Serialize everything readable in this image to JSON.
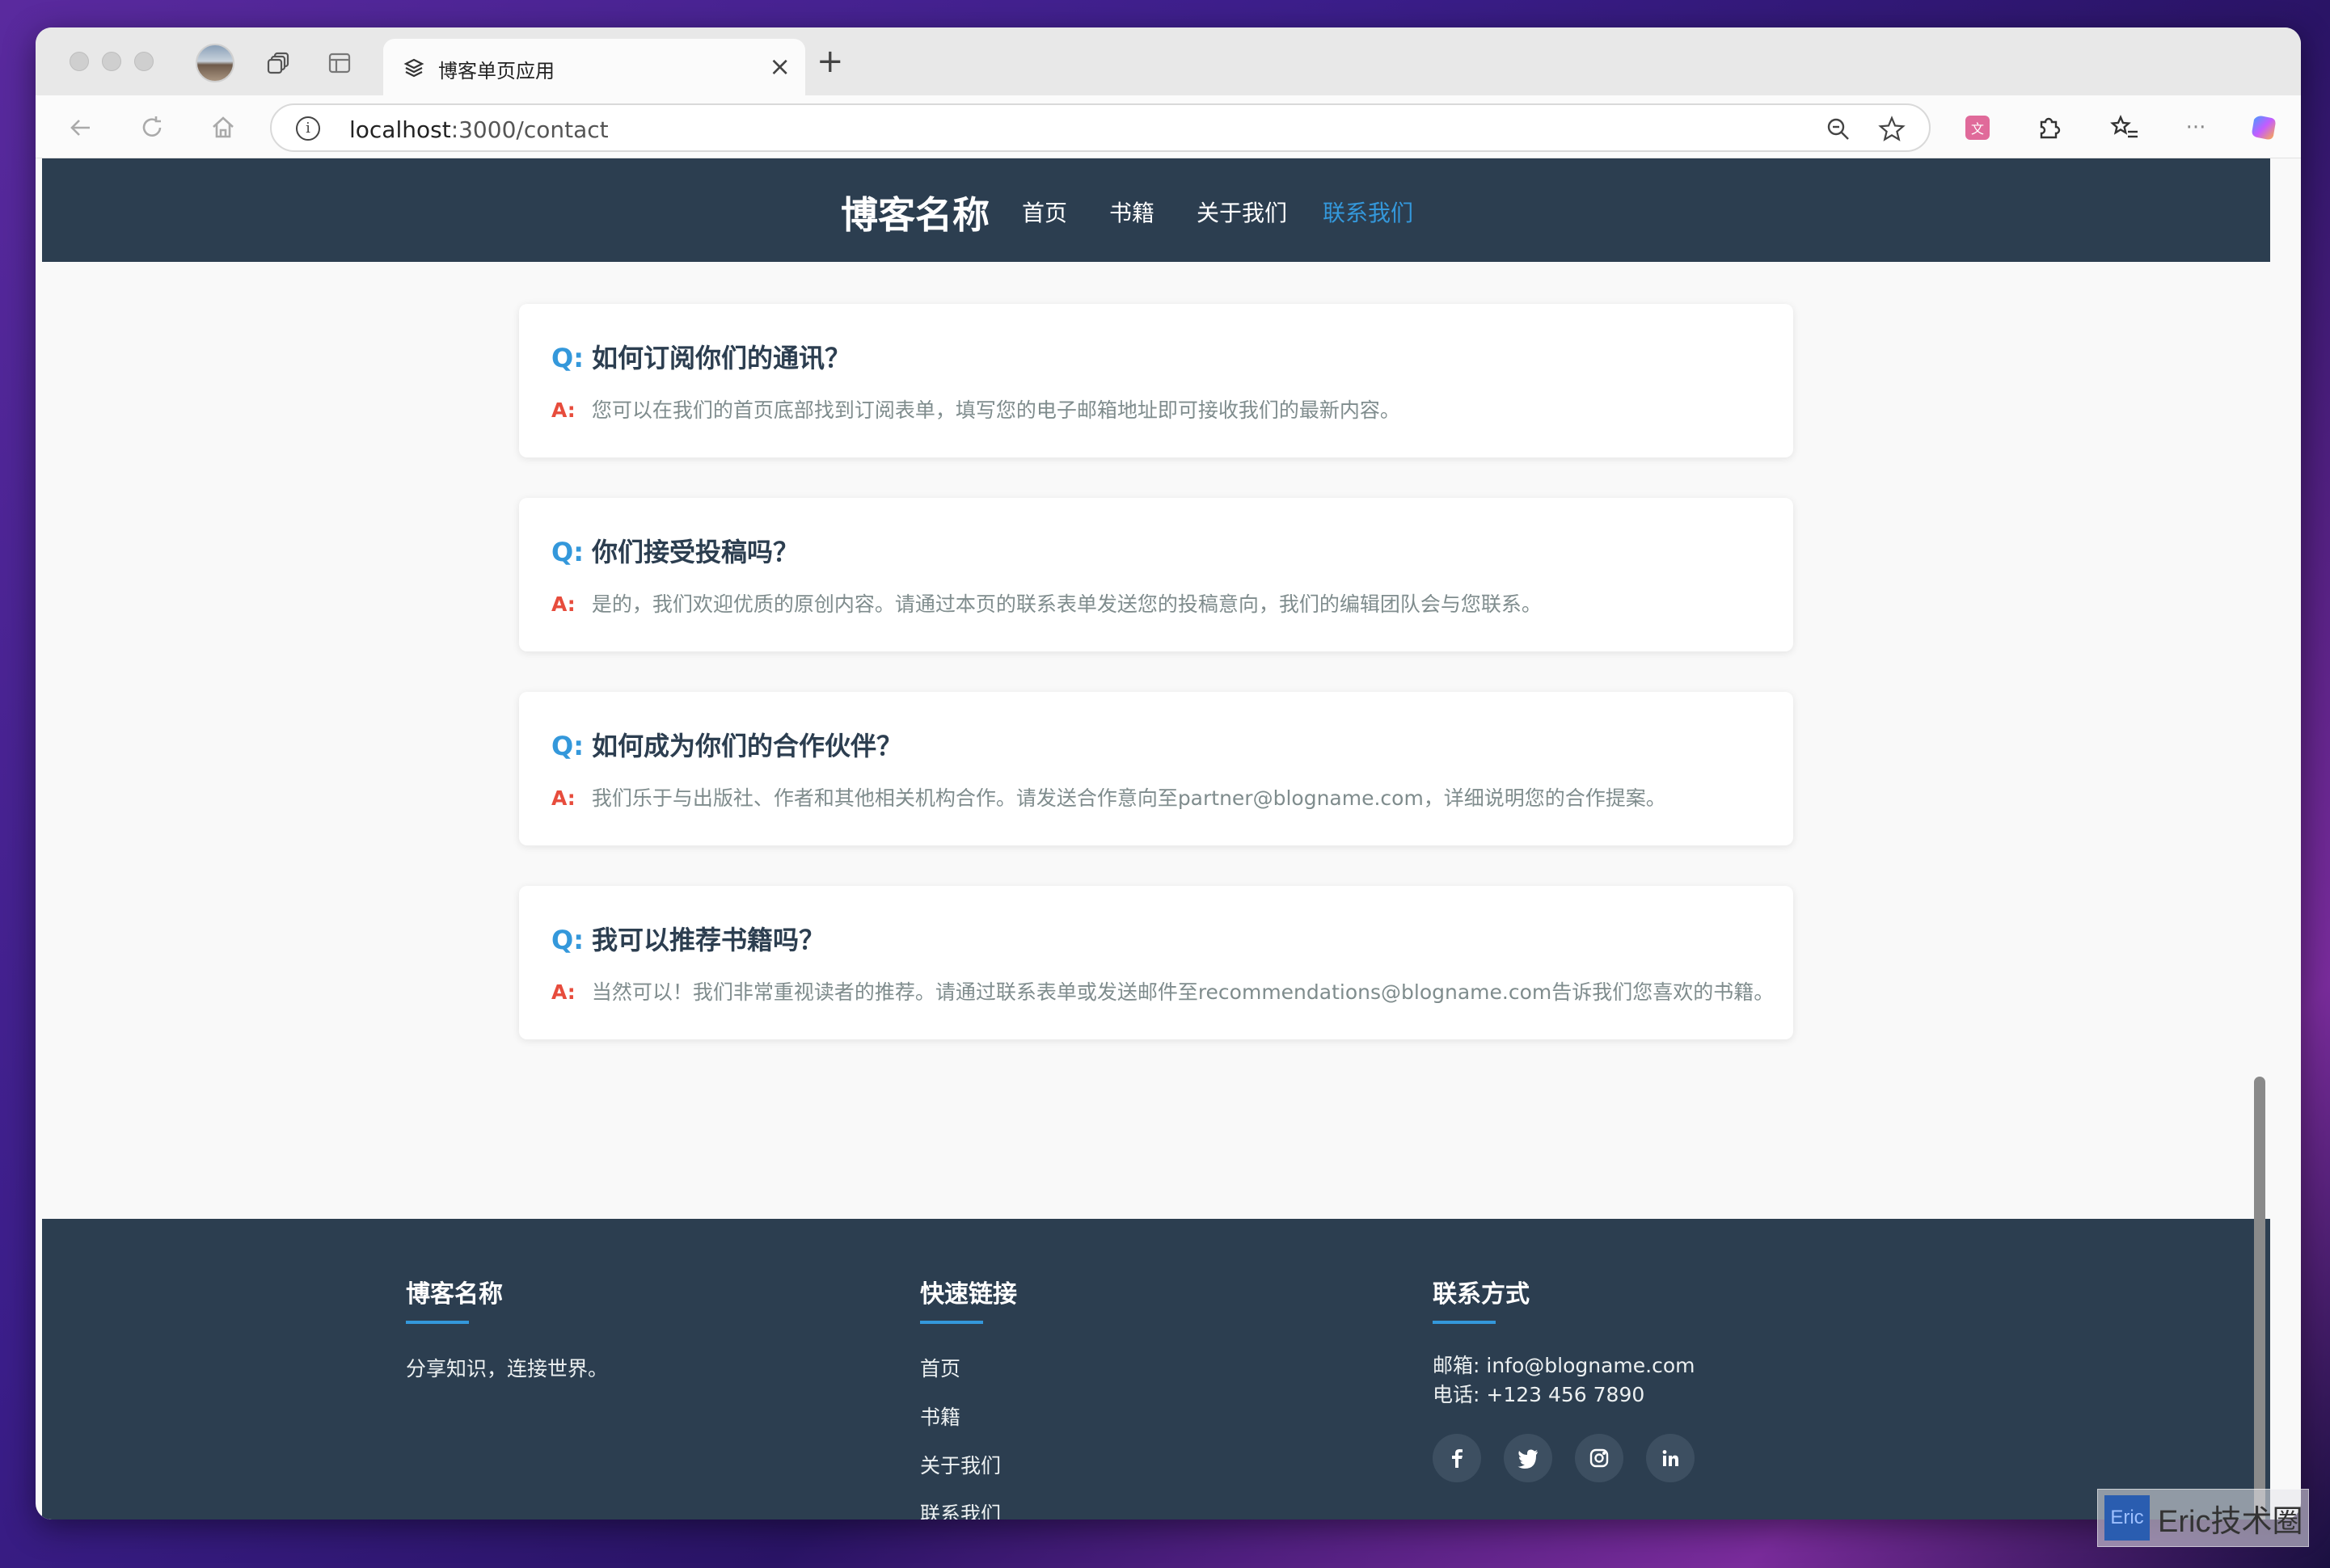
{
  "browser": {
    "tab_title": "博客单页应用",
    "url_host": "localhost",
    "url_rest": ":3000/contact",
    "new_tab_symbol": "+",
    "close_symbol": "×",
    "more_symbol": "···"
  },
  "header": {
    "brand": "博客名称",
    "nav": [
      "首页",
      "书籍",
      "关于我们",
      "联系我们"
    ],
    "active_index": 3
  },
  "faq": {
    "q_prefix": "Q:",
    "a_prefix": "A:",
    "items": [
      {
        "q": "如何订阅你们的通讯？",
        "a": "您可以在我们的首页底部找到订阅表单，填写您的电子邮箱地址即可接收我们的最新内容。"
      },
      {
        "q": "你们接受投稿吗？",
        "a": "是的，我们欢迎优质的原创内容。请通过本页的联系表单发送您的投稿意向，我们的编辑团队会与您联系。"
      },
      {
        "q": "如何成为你们的合作伙伴？",
        "a": "我们乐于与出版社、作者和其他相关机构合作。请发送合作意向至partner@blogname.com，详细说明您的合作提案。"
      },
      {
        "q": "我可以推荐书籍吗？",
        "a": "当然可以！我们非常重视读者的推荐。请通过联系表单或发送邮件至recommendations@blogname.com告诉我们您喜欢的书籍。"
      }
    ]
  },
  "footer": {
    "about_title": "博客名称",
    "about_text": "分享知识，连接世界。",
    "links_title": "快速链接",
    "links": [
      "首页",
      "书籍",
      "关于我们",
      "联系我们"
    ],
    "contact_title": "联系方式",
    "email": "邮箱: info@blogname.com",
    "phone": "电话: +123 456 7890",
    "socials": [
      "f",
      "t",
      "ig",
      "in"
    ]
  },
  "watermark": {
    "logo": "Eric",
    "text": "Eric技术圈"
  },
  "colors": {
    "header_bg": "#2c3e50",
    "accent": "#3498db",
    "answer_mark": "#e74c3c"
  }
}
